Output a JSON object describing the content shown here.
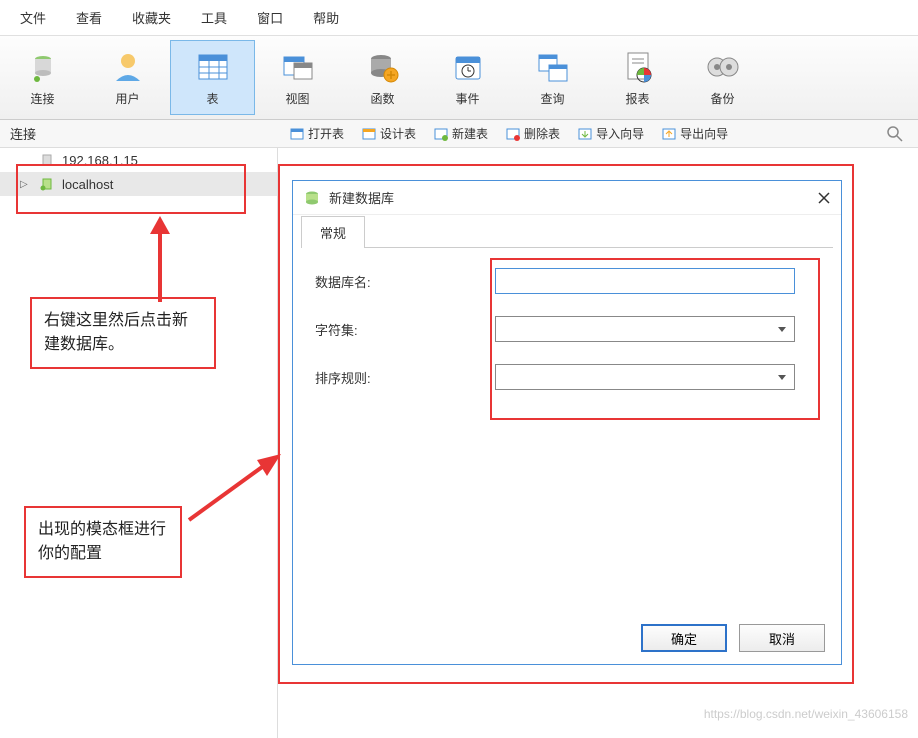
{
  "menu": {
    "file": "文件",
    "view": "查看",
    "favorites": "收藏夹",
    "tools": "工具",
    "window": "窗口",
    "help": "帮助"
  },
  "toolbar": {
    "connect": "连接",
    "user": "用户",
    "table": "表",
    "view": "视图",
    "function": "函数",
    "event": "事件",
    "query": "查询",
    "report": "报表",
    "backup": "备份"
  },
  "sub": {
    "label": "连接",
    "open": "打开表",
    "design": "设计表",
    "new": "新建表",
    "delete": "删除表",
    "import": "导入向导",
    "export": "导出向导"
  },
  "tree": {
    "item1": "192.168.1.15",
    "item2": "localhost"
  },
  "anno": {
    "a1": "右键这里然后点击新建数据库。",
    "a2": "出现的模态框进行你的配置"
  },
  "dialog": {
    "title": "新建数据库",
    "tab": "常规",
    "dbname": "数据库名:",
    "charset": "字符集:",
    "collation": "排序规则:",
    "ok": "确定",
    "cancel": "取消"
  },
  "watermark": "https://blog.csdn.net/weixin_43606158"
}
